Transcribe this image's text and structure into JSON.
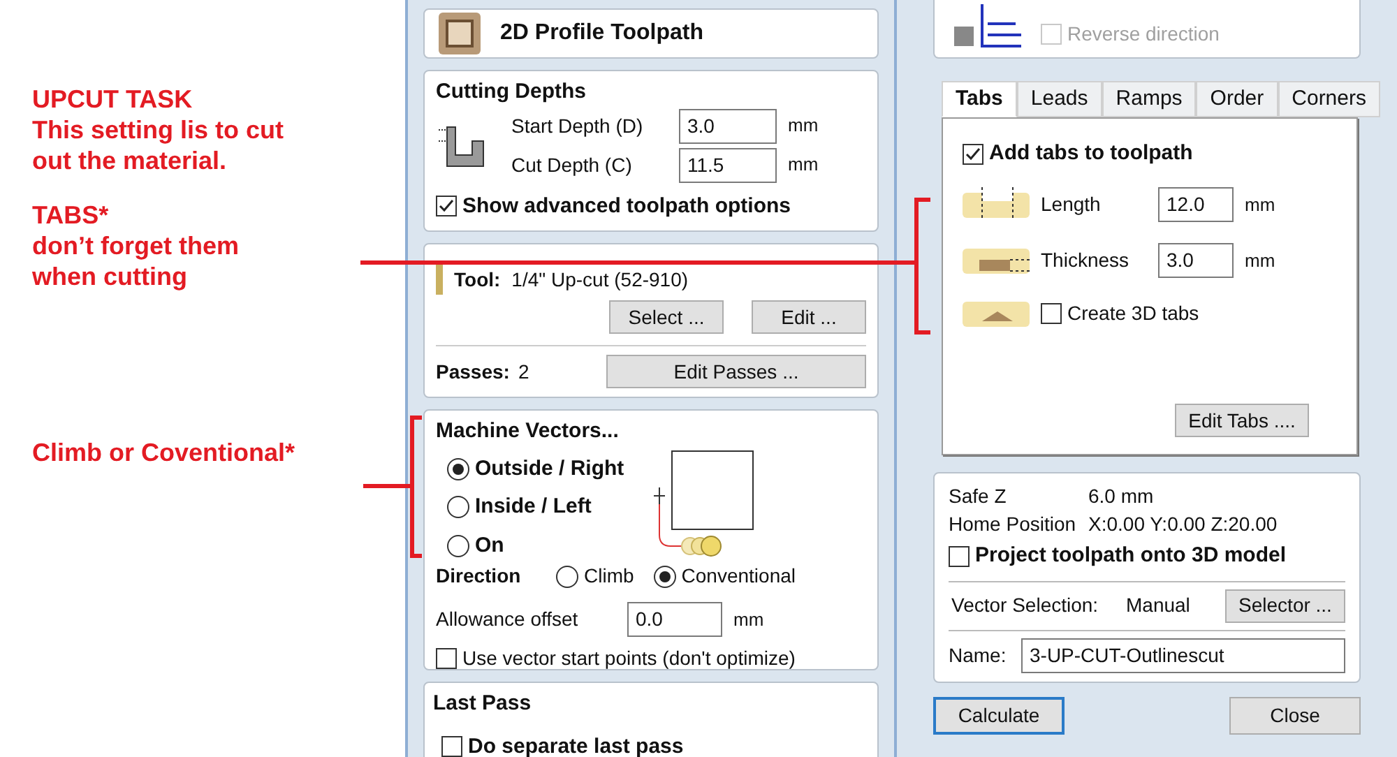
{
  "annotations": [
    {
      "title": "UPCUT TASK",
      "body": "This setting lis to cut\nout the material."
    },
    {
      "title": "TABS*",
      "body": "don’t forget them\nwhen cutting"
    },
    {
      "title": "Climb or Coventional*"
    }
  ],
  "header": {
    "title": "2D Profile Toolpath"
  },
  "cutting_depths": {
    "title": "Cutting Depths",
    "fields": [
      {
        "label": "Start Depth (D)",
        "value": "3.0",
        "unit": "mm"
      },
      {
        "label": "Cut Depth (C)",
        "value": "11.5",
        "unit": "mm"
      }
    ],
    "advanced": {
      "label": "Show advanced toolpath options",
      "checked": true
    }
  },
  "tool": {
    "label": "Tool:",
    "name": "1/4\" Up-cut (52-910)",
    "buttons": [
      "Select ...",
      "Edit ..."
    ],
    "passes_label": "Passes:",
    "passes": "2",
    "passes_button": "Edit Passes ..."
  },
  "machine_vectors": {
    "title": "Machine Vectors...",
    "options": [
      {
        "label": "Outside / Right",
        "selected": true
      },
      {
        "label": "Inside / Left",
        "selected": false
      },
      {
        "label": "On",
        "selected": false
      }
    ],
    "direction_label": "Direction",
    "directions": [
      {
        "label": "Climb",
        "selected": false
      },
      {
        "label": "Conventional",
        "selected": true
      }
    ],
    "allowance": {
      "label": "Allowance offset",
      "value": "0.0",
      "unit": "mm"
    },
    "start_points": {
      "label": "Use vector start points (don't optimize)",
      "checked": false
    }
  },
  "last_pass": {
    "title": "Last Pass",
    "separate": {
      "label": "Do separate last pass",
      "checked": false
    }
  },
  "ramp_panel": {
    "reverse": {
      "label": "Reverse direction",
      "checked": false,
      "disabled": true
    }
  },
  "tabs": [
    {
      "label": "Tabs",
      "selected": true
    },
    {
      "label": "Leads",
      "selected": false
    },
    {
      "label": "Ramps",
      "selected": false
    },
    {
      "label": "Order",
      "selected": false
    },
    {
      "label": "Corners",
      "selected": false
    }
  ],
  "tab_content": {
    "add_tabs": {
      "label": "Add tabs to toolpath",
      "checked": true
    },
    "fields": [
      {
        "label": "Length",
        "value": "12.0",
        "unit": "mm"
      },
      {
        "label": "Thickness",
        "value": "3.0",
        "unit": "mm"
      }
    ],
    "create_3d": {
      "label": "Create 3D tabs",
      "checked": false
    },
    "button": "Edit Tabs ...."
  },
  "info": {
    "rows": [
      {
        "label": "Safe Z",
        "value": "6.0 mm"
      },
      {
        "label": "Home Position",
        "value": "X:0.00 Y:0.00 Z:20.00"
      }
    ],
    "project": {
      "label": "Project toolpath onto 3D model",
      "checked": false
    },
    "vector_selection": {
      "label": "Vector Selection:",
      "value": "Manual",
      "button": "Selector ..."
    },
    "name": {
      "label": "Name:",
      "value": "3-UP-CUT-Outlinescut"
    }
  },
  "footer": {
    "buttons": [
      {
        "label": "Calculate",
        "focused": true
      },
      {
        "label": "Close",
        "focused": false
      }
    ]
  }
}
